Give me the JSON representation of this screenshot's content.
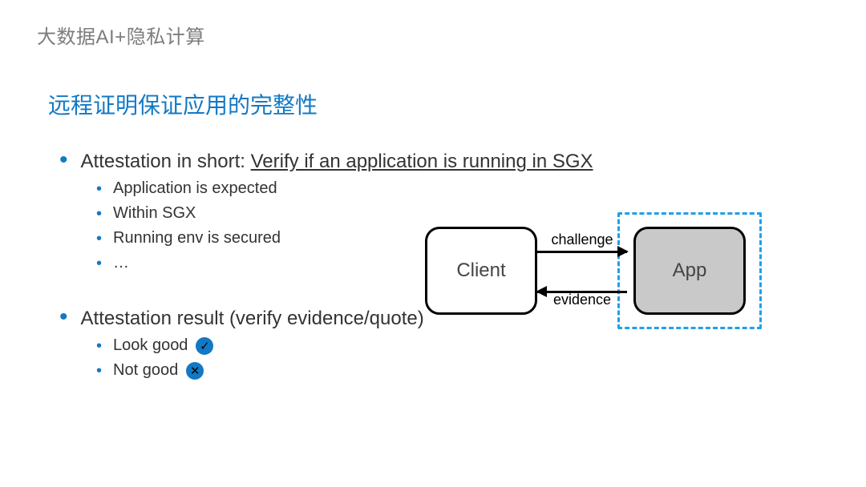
{
  "breadcrumb": "大数据AI+隐私计算",
  "title": "远程证明保证应用的完整性",
  "bullets": {
    "attestation": {
      "lead": "Attestation in short: ",
      "underlined": "Verify if an application is running in SGX",
      "sub": [
        "Application is expected",
        "Within SGX",
        "Running env is secured",
        "…"
      ]
    },
    "result": {
      "text": "Attestation result (verify evidence/quote)",
      "sub": [
        {
          "label": "Look good",
          "badge": "✓"
        },
        {
          "label": "Not good",
          "badge": "✕"
        }
      ]
    }
  },
  "diagram": {
    "client": "Client",
    "app": "App",
    "challenge": "challenge",
    "evidence": "evidence"
  }
}
